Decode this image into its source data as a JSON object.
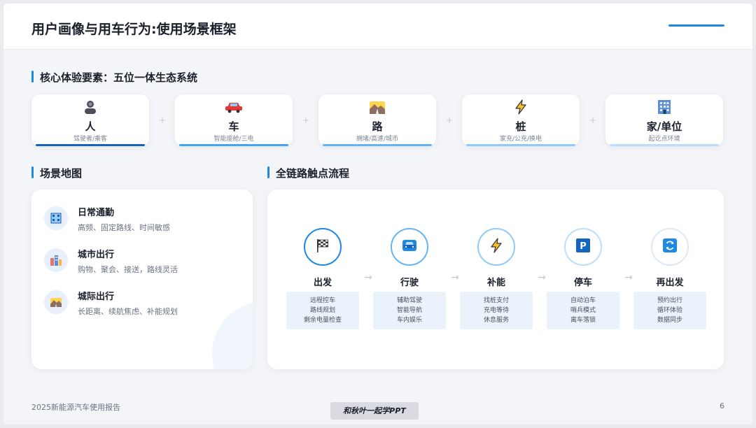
{
  "header": {
    "title": "用户画像与用车行为:使用场景框架"
  },
  "ecosystem": {
    "title": "核心体验要素：五位一体生态系统",
    "pillars": [
      {
        "name": "人",
        "desc": "驾驶者/乘客",
        "icon": "person-icon",
        "bar_color": "#1565c0"
      },
      {
        "name": "车",
        "desc": "智能座舱/三电",
        "icon": "car-icon",
        "bar_color": "#42a5f5"
      },
      {
        "name": "路",
        "desc": "拥堵/高速/城市",
        "icon": "road-icon",
        "bar_color": "#64b5f6"
      },
      {
        "name": "桩",
        "desc": "家充/公充/换电",
        "icon": "lightning-icon",
        "bar_color": "#90caf9"
      },
      {
        "name": "家/单位",
        "desc": "起讫点环境",
        "icon": "building-icon",
        "bar_color": "#bbdefb"
      }
    ]
  },
  "scene_map": {
    "title": "场景地图",
    "items": [
      {
        "name": "日常通勤",
        "desc": "高频、固定路线、时间敏感",
        "icon": "office-icon"
      },
      {
        "name": "城市出行",
        "desc": "购物、聚会、接送，路线灵活",
        "icon": "city-icon"
      },
      {
        "name": "城际出行",
        "desc": "长距离、续航焦虑、补能规划",
        "icon": "mountain-road-icon"
      }
    ]
  },
  "flow": {
    "title": "全链路触点流程",
    "steps": [
      {
        "name": "出发",
        "icon": "checkered-flag-icon",
        "lines": [
          "远程控车",
          "路线规划",
          "剩余电量检查"
        ]
      },
      {
        "name": "行驶",
        "icon": "car-icon",
        "lines": [
          "辅助驾驶",
          "智能导航",
          "车内娱乐"
        ]
      },
      {
        "name": "补能",
        "icon": "lightning-icon",
        "lines": [
          "找桩支付",
          "充电等待",
          "休息服务"
        ]
      },
      {
        "name": "停车",
        "icon": "parking-icon",
        "lines": [
          "自动泊车",
          "哨兵模式",
          "离车落锁"
        ]
      },
      {
        "name": "再出发",
        "icon": "refresh-icon",
        "lines": [
          "预约出行",
          "循环体验",
          "数据同步"
        ]
      }
    ],
    "arrow": "→"
  },
  "footer": {
    "text": "2025新能源汽车使用报告",
    "page": "6"
  },
  "watermark": "和秋叶一起学PPT",
  "colors": {
    "accent": "#1e88e5",
    "card_bg": "#ffffff",
    "chip_bg": "#eaf2fc"
  }
}
